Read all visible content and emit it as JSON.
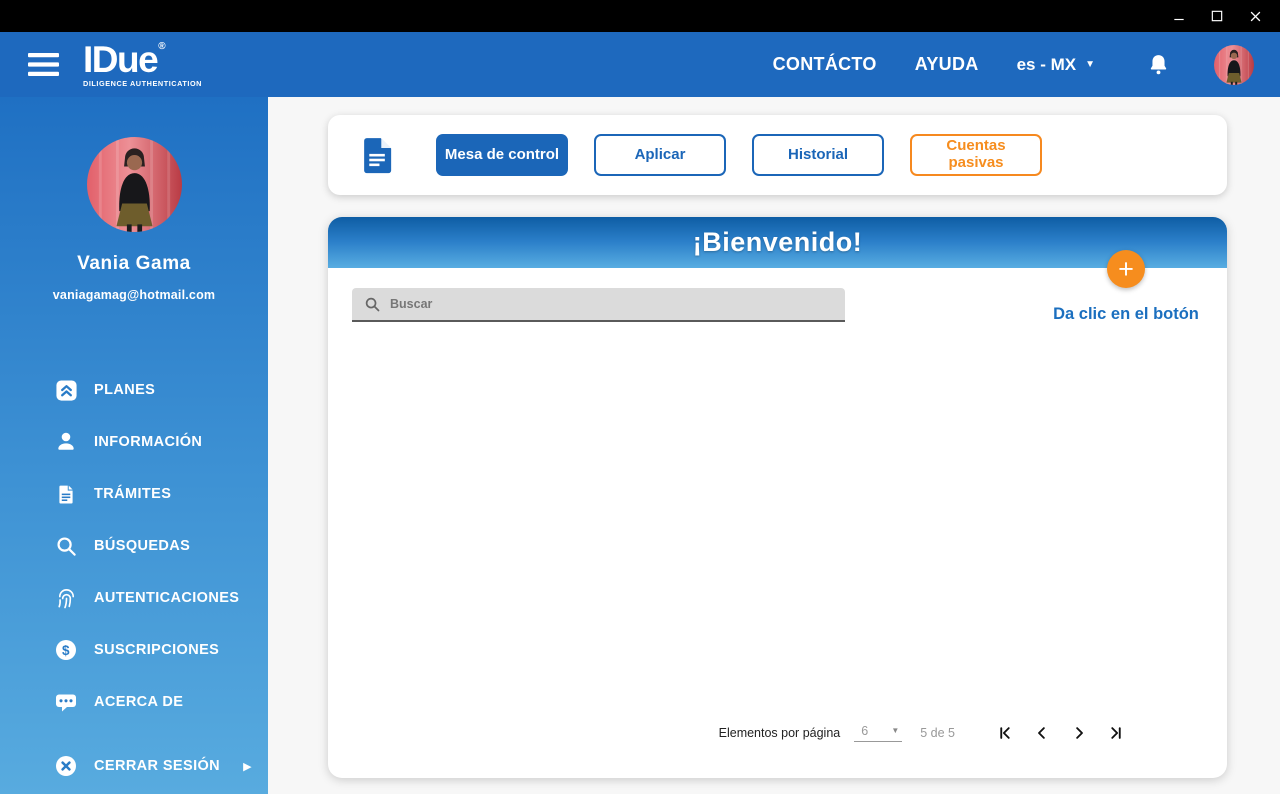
{
  "colors": {
    "titlebar_black": "#000000",
    "header_blue": "#1E69BE",
    "sidebar_gradient_top": "#1F70C3",
    "sidebar_gradient_bottom": "#58ABDF",
    "banner_gradient_top": "#0E5DA4",
    "banner_gradient_bottom": "#58ADE1",
    "primary_blue": "#1B66B8",
    "link_blue": "#1B6FBF",
    "accent_orange": "#F68D1E",
    "content_background": "#F7F7F7",
    "search_gray": "#DBDBDB"
  },
  "titlebar": {
    "window_controls": [
      "minimize-icon",
      "maximize-icon",
      "close-icon"
    ]
  },
  "header": {
    "logo": {
      "text": "IDue",
      "registered": "®",
      "tagline": "DILIGENCE AUTHENTICATION"
    },
    "nav": [
      {
        "label": "CONTÁCTO"
      },
      {
        "label": "AYUDA"
      }
    ],
    "language": {
      "value": "es - MX",
      "arrow": "▼"
    },
    "icons": [
      "hamburger-icon",
      "bell-icon",
      "avatar"
    ]
  },
  "sidebar": {
    "user": {
      "name": "Vania Gama",
      "email": "vaniagamag@hotmail.com"
    },
    "items": [
      {
        "label": "PLANES",
        "icon": "double-chevron-up-icon"
      },
      {
        "label": "INFORMACIÓN",
        "icon": "person-icon"
      },
      {
        "label": "TRÁMITES",
        "icon": "document-icon"
      },
      {
        "label": "BÚSQUEDAS",
        "icon": "search-icon"
      },
      {
        "label": "AUTENTICACIONES",
        "icon": "fingerprint-icon"
      },
      {
        "label": "SUSCRIPCIONES",
        "icon": "dollar-circle-icon"
      },
      {
        "label": "ACERCA DE",
        "icon": "chat-bubble-icon"
      }
    ],
    "logout": {
      "label": "CERRAR SESIÓN",
      "icon": "close-circle-icon",
      "arrow": "▶"
    }
  },
  "tabs": [
    {
      "label": "Mesa de control",
      "active": true
    },
    {
      "label": "Aplicar",
      "active": false
    },
    {
      "label": "Historial",
      "active": false
    },
    {
      "label": "Cuentas pasivas",
      "active": false
    }
  ],
  "main": {
    "welcome_title": "¡Bienvenido!",
    "search_placeholder": "Buscar",
    "add_button": "+",
    "add_hint": "Da clic en el botón",
    "pagination": {
      "label": "Elementos por página",
      "per_page": "6",
      "range": "5 de 5",
      "nav_icons": [
        "first-page-icon",
        "previous-page-icon",
        "next-page-icon",
        "last-page-icon"
      ]
    }
  }
}
